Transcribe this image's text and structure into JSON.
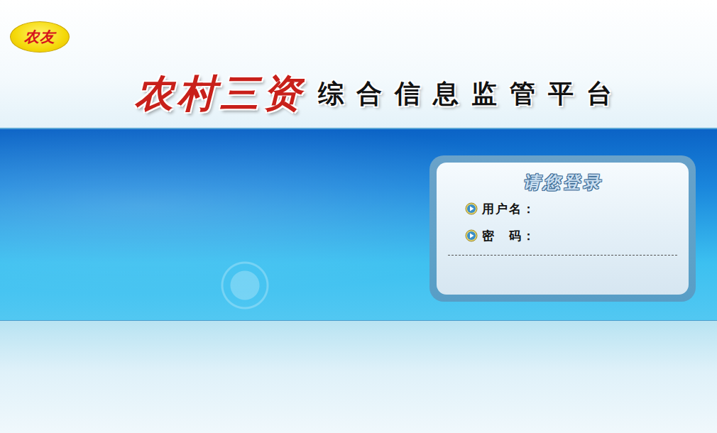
{
  "logo": "农友",
  "title": {
    "highlight": "农村三资",
    "rest": "综合信息监管平台"
  },
  "login": {
    "heading": "请您登录",
    "fields": [
      {
        "label": "用户名："
      },
      {
        "label": "密　码："
      }
    ]
  }
}
